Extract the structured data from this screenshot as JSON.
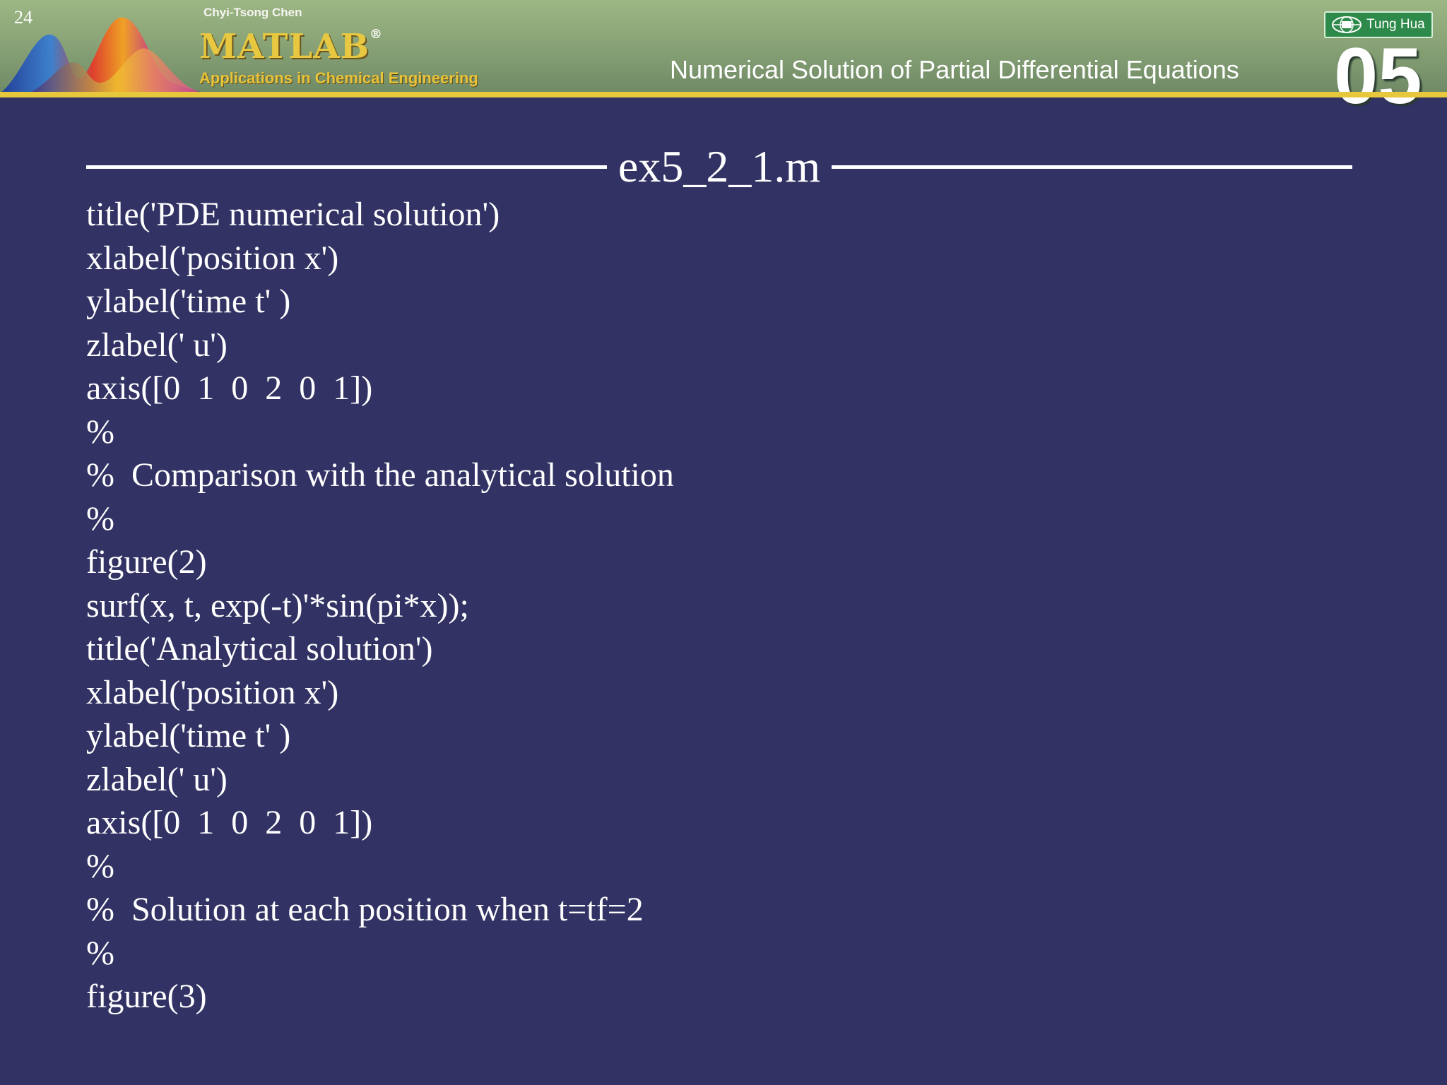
{
  "slide": {
    "number": "24",
    "background_color": "#323264"
  },
  "header": {
    "author": "Chyi-Tsong Chen",
    "book_title": "MATLAB",
    "registered_mark": "®",
    "book_subtitle": "Applications in Chemical Engineering",
    "publisher": "Tung Hua",
    "chapter_title": "Numerical Solution of Partial Differential Equations",
    "chapter_number": "05",
    "stripe_color": "#e7c83c"
  },
  "content": {
    "filename": "ex5_2_1.m",
    "code_lines": [
      "title('PDE numerical solution')",
      "xlabel('position x')",
      "ylabel('time t' )",
      "zlabel(' u')",
      "axis([0  1  0  2  0  1])",
      "%",
      "%  Comparison with the analytical solution",
      "%",
      "figure(2)",
      "surf(x, t, exp(-t)'*sin(pi*x));",
      "title('Analytical solution')",
      "xlabel('position x')",
      "ylabel('time t' )",
      "zlabel(' u')",
      "axis([0  1  0  2  0  1])",
      "%",
      "%  Solution at each position when t=tf=2",
      "%",
      "figure(3)"
    ]
  }
}
